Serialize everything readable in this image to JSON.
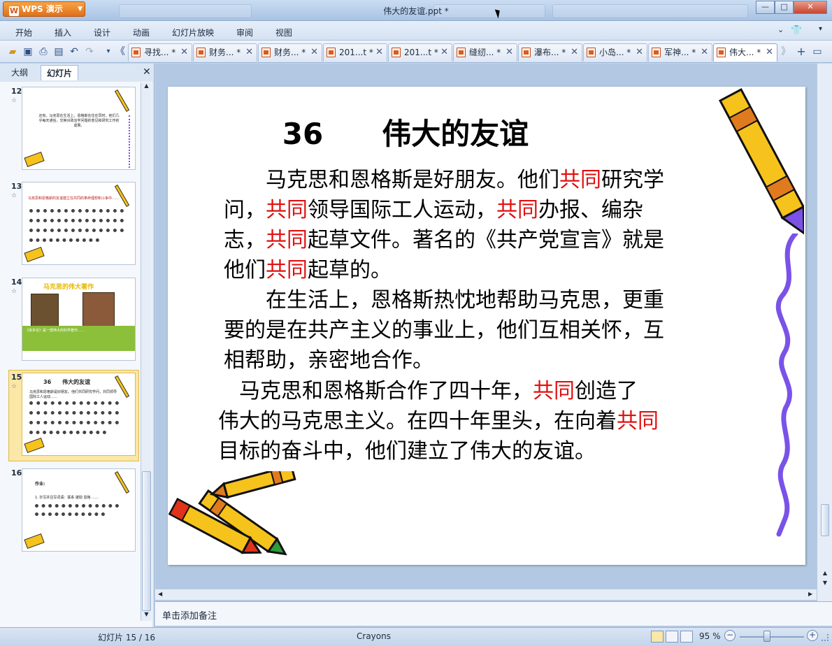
{
  "app": {
    "name": "WPS 演示",
    "window_title": "伟大的友谊.ppt *",
    "window_buttons": {
      "minimize": "—",
      "maximize": "□",
      "close": "✕"
    }
  },
  "menu": [
    "开始",
    "插入",
    "设计",
    "动画",
    "幻灯片放映",
    "审阅",
    "视图"
  ],
  "toolbar": {
    "icons": [
      "open-icon",
      "save-icon",
      "print-icon",
      "print-preview-icon",
      "undo-icon",
      "redo-icon",
      "customize-icon",
      "tabs-left-icon"
    ],
    "doc_tabs": [
      {
        "label": "寻找... *"
      },
      {
        "label": "财务... *"
      },
      {
        "label": "财务... *"
      },
      {
        "label": "201...t *"
      },
      {
        "label": "201...t *"
      },
      {
        "label": "缝纫... *"
      },
      {
        "label": "瀑布... *"
      },
      {
        "label": "小岛... *"
      },
      {
        "label": "军神... *"
      },
      {
        "label": "伟大... *"
      }
    ],
    "active_tab": 9
  },
  "left_panel": {
    "tabs": [
      "大纲",
      "幻灯片"
    ],
    "active_tab": "幻灯片",
    "close": "✕",
    "slides": [
      {
        "number": "12",
        "has_star": true,
        "text": "还有，马克思在生活上，恩格斯在住在同时，他们几乎每天通信，交换对政治学问题的意见和研究工作的成果。"
      },
      {
        "number": "13",
        "has_star": true,
        "text": "马克思和恩格斯的友谊建立在共同的革命理想和斗争中……"
      },
      {
        "number": "14",
        "has_star": true,
        "heading": "马克思的伟大著作",
        "text": "《资本论》是一部伟大的科学著作……"
      },
      {
        "number": "15",
        "has_star": true,
        "selected": true,
        "heading": "36　　伟大的友谊",
        "text": "马克思和恩格斯是好朋友。他们共同研究学问，共同领导国际工人运动……"
      },
      {
        "number": "16",
        "has_star": false,
        "heading": "作业:",
        "text": "1. 抄写并且写词语：联系 援助 恩格 ……"
      }
    ]
  },
  "slide": {
    "title": "36　　伟大的友谊",
    "paragraphs": [
      {
        "lines": [
          [
            {
              "t": "　　马克思和恩格斯是好朋友。他们"
            },
            {
              "t": "共同",
              "red": true
            },
            {
              "t": "研究学"
            }
          ],
          [
            {
              "t": "问，"
            },
            {
              "t": "共同",
              "red": true
            },
            {
              "t": "领导国际工人运动，"
            },
            {
              "t": "共同",
              "red": true
            },
            {
              "t": "办报、编杂"
            }
          ],
          [
            {
              "t": "志，"
            },
            {
              "t": "共同",
              "red": true
            },
            {
              "t": "起草文件。著名的《共产党宣言》就是"
            }
          ],
          [
            {
              "t": "他们"
            },
            {
              "t": "共同",
              "red": true
            },
            {
              "t": "起草的。"
            }
          ]
        ]
      },
      {
        "lines": [
          [
            {
              "t": "　　在生活上，恩格斯热忱地帮助马克思，更重"
            }
          ],
          [
            {
              "t": "要的是在共产主义的事业上，他们互相关怀，互"
            }
          ],
          [
            {
              "t": "相帮助，亲密地合作。"
            }
          ]
        ]
      },
      {
        "lines": [
          [
            {
              "t": "　马克思和恩格斯合作了四十年，"
            },
            {
              "t": "共同",
              "red": true
            },
            {
              "t": "创造了"
            }
          ],
          [
            {
              "t": "伟大的马克思主义。在四十年里头，在向着"
            },
            {
              "t": "共同",
              "red": true
            }
          ],
          [
            {
              "t": "目标的奋斗中，他们建立了伟大的友谊。"
            }
          ]
        ]
      }
    ]
  },
  "notes": {
    "placeholder": "单击添加备注"
  },
  "status": {
    "slide_counter": "幻灯片 15 / 16",
    "theme": "Crayons",
    "zoom": "95 %",
    "zoom_value": 95
  },
  "colors": {
    "accent": "#e07a1f",
    "highlight_red": "#e01010",
    "selection": "#fbe7a6",
    "crayon_yellow": "#f6c21c",
    "squiggle_purple": "#7a52e8"
  }
}
